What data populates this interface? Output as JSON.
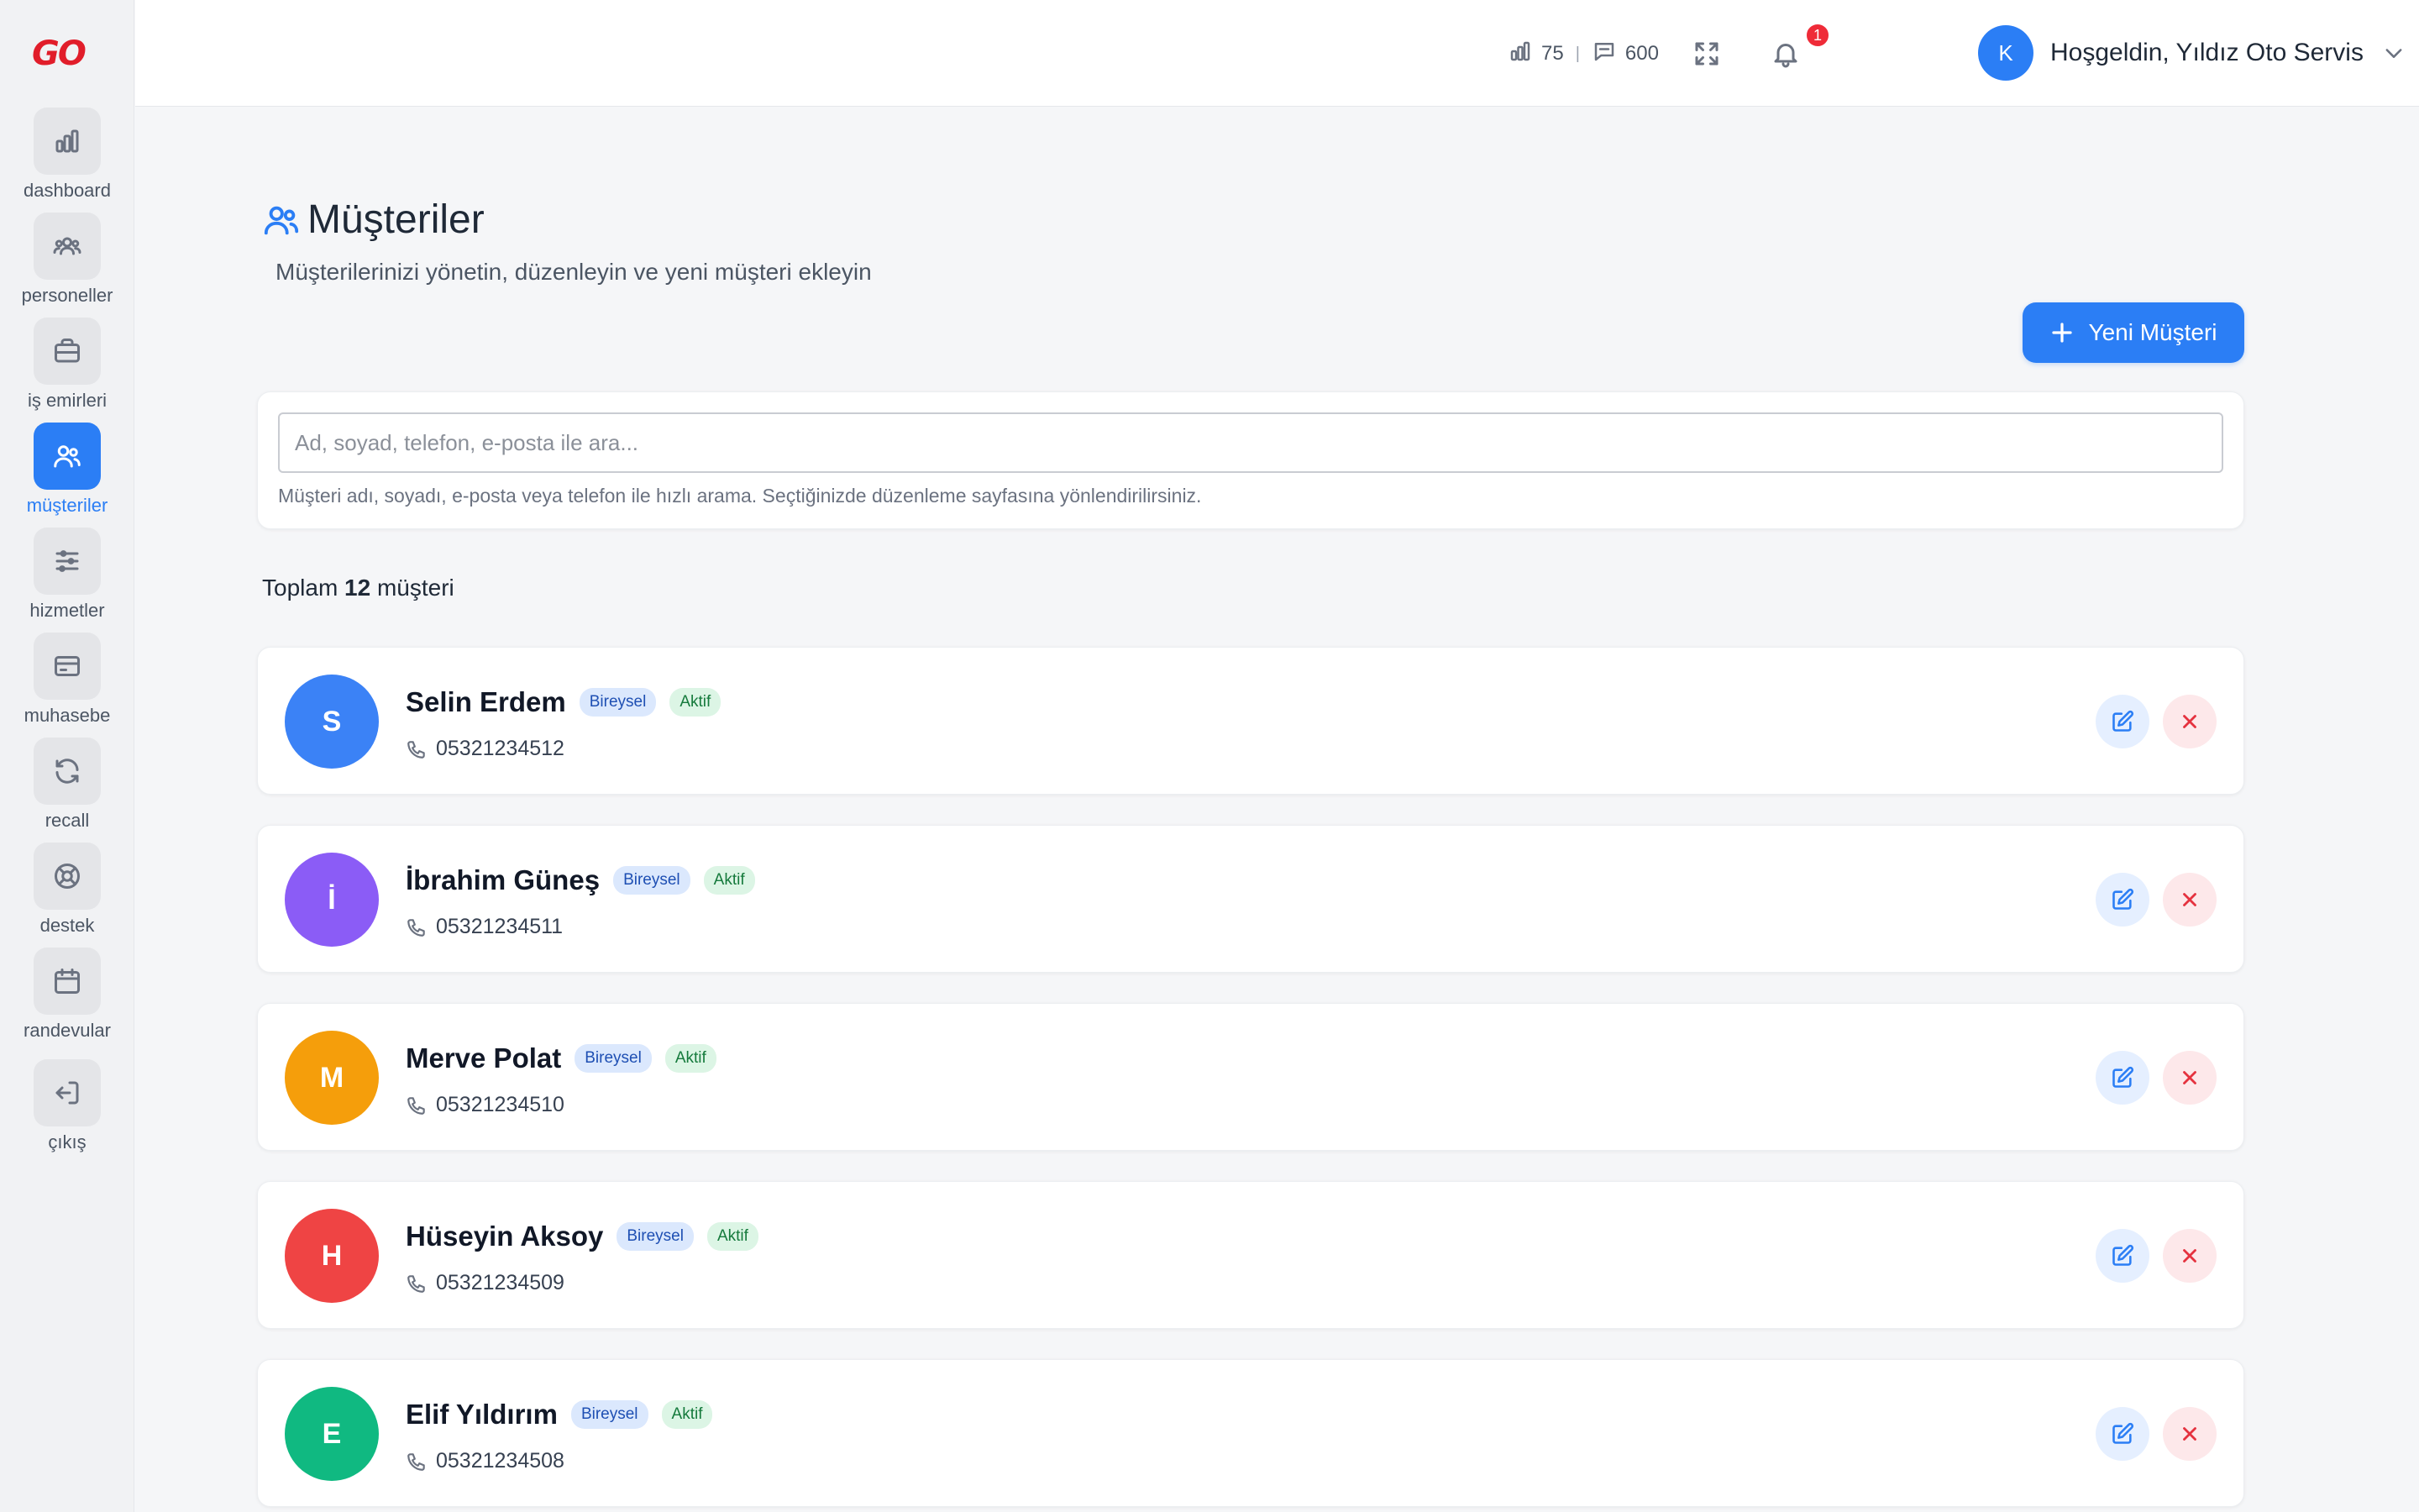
{
  "brand": {
    "logo_text": "GO"
  },
  "sidebar": {
    "items": [
      {
        "label": "dashboard",
        "icon": "bar-chart-icon",
        "active": false
      },
      {
        "label": "personeller",
        "icon": "users-group-icon",
        "active": false
      },
      {
        "label": "iş emirleri",
        "icon": "briefcase-icon",
        "active": false
      },
      {
        "label": "müşteriler",
        "icon": "users-icon",
        "active": true
      },
      {
        "label": "hizmetler",
        "icon": "sliders-icon",
        "active": false
      },
      {
        "label": "muhasebe",
        "icon": "credit-card-icon",
        "active": false
      },
      {
        "label": "recall",
        "icon": "refresh-icon",
        "active": false
      },
      {
        "label": "destek",
        "icon": "lifebuoy-icon",
        "active": false
      },
      {
        "label": "randevular",
        "icon": "calendar-icon",
        "active": false
      },
      {
        "label": "çıkış",
        "icon": "logout-icon",
        "active": false
      }
    ]
  },
  "topbar": {
    "stat_chart_value": "75",
    "stat_sep": "|",
    "stat_message_value": "600",
    "notification_count": "1",
    "user_initial": "K",
    "user_greeting": "Hoşgeldin, Yıldız Oto Servis"
  },
  "page": {
    "title": "Müşteriler",
    "subtitle": "Müşterilerinizi yönetin, düzenleyin ve yeni müşteri ekleyin",
    "new_button_label": "Yeni Müşteri"
  },
  "search": {
    "placeholder": "Ad, soyad, telefon, e-posta ile ara...",
    "value": "",
    "hint": "Müşteri adı, soyadı, e-posta veya telefon ile hızlı arama. Seçtiğinizde düzenleme sayfasına yönlendirilirsiniz."
  },
  "summary": {
    "prefix": "Toplam",
    "count": "12",
    "suffix": "müşteri"
  },
  "customers": [
    {
      "initial": "S",
      "name": "Selin Erdem",
      "type": "Bireysel",
      "status": "Aktif",
      "phone": "05321234512",
      "color": "#3b82f6"
    },
    {
      "initial": "İ",
      "name": "İbrahim Güneş",
      "type": "Bireysel",
      "status": "Aktif",
      "phone": "05321234511",
      "color": "#8b5cf6"
    },
    {
      "initial": "M",
      "name": "Merve Polat",
      "type": "Bireysel",
      "status": "Aktif",
      "phone": "05321234510",
      "color": "#f59e0b"
    },
    {
      "initial": "H",
      "name": "Hüseyin Aksoy",
      "type": "Bireysel",
      "status": "Aktif",
      "phone": "05321234509",
      "color": "#ef4444"
    },
    {
      "initial": "E",
      "name": "Elif Yıldırım",
      "type": "Bireysel",
      "status": "Aktif",
      "phone": "05321234508",
      "color": "#10b981"
    }
  ],
  "colors": {
    "accent": "#2b7ef5",
    "danger": "#e5323f",
    "badge_red": "#ef2b38"
  }
}
